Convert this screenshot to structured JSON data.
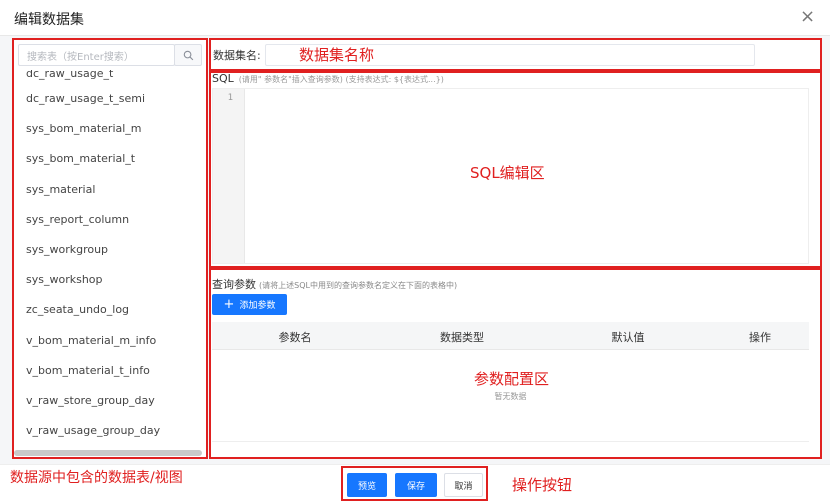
{
  "dialog": {
    "title": "编辑数据集",
    "close_icon": "×"
  },
  "left_panel": {
    "search_placeholder": "搜索表（按Enter搜索）",
    "tables": [
      "dc_raw_usage_t",
      "dc_raw_usage_t_semi",
      "sys_bom_material_m",
      "sys_bom_material_t",
      "sys_material",
      "sys_report_column",
      "sys_workgroup",
      "sys_workshop",
      "zc_seata_undo_log",
      "v_bom_material_m_info",
      "v_bom_material_t_info",
      "v_raw_store_group_day",
      "v_raw_usage_group_day"
    ]
  },
  "dataset": {
    "name_label": "数据集名:",
    "name_value": ""
  },
  "sql": {
    "label": "SQL",
    "hint": "(请用\" 参数名\"插入查询参数)   (支持表达式: ${表达式...})",
    "line_numbers": [
      "1"
    ]
  },
  "params": {
    "label": "查询参数",
    "hint": "(请将上述SQL中用到的查询参数名定义在下面的表格中)",
    "add_button": "添加参数",
    "add_icon": "+",
    "columns": [
      "参数名",
      "数据类型",
      "默认值",
      "操作"
    ],
    "empty_text": "暂无数据"
  },
  "footer": {
    "preview": "预览",
    "save": "保存",
    "cancel": "取消"
  },
  "annotations": {
    "dataset_name": "数据集名称",
    "sql_area": "SQL编辑区",
    "params_area": "参数配置区",
    "data_source": "数据源中包含的数据表/视图",
    "actions": "操作按钮"
  },
  "colors": {
    "primary": "#1677ff",
    "annotation_red": "#e02020"
  }
}
